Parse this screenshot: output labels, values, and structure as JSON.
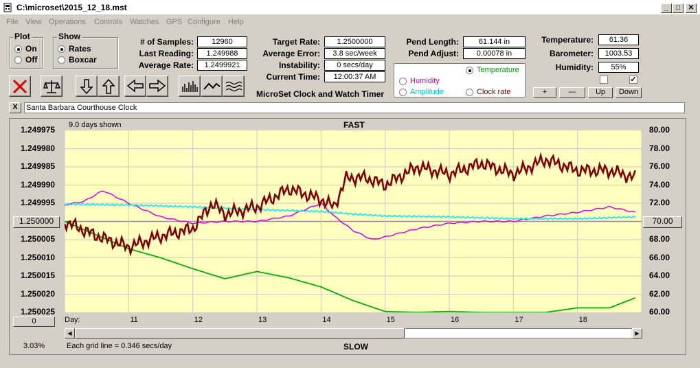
{
  "window": {
    "title": "C:\\microset\\2015_12_18.mst"
  },
  "menu": [
    "File",
    "View",
    "Operations",
    "Controls",
    "Watches",
    "GPS",
    "Configure",
    "Help"
  ],
  "plot_group": {
    "label": "Plot",
    "options": [
      "On",
      "Off"
    ],
    "selected": "On"
  },
  "show_group": {
    "label": "Show",
    "options": [
      "Rates",
      "Boxcar"
    ],
    "selected": "Rates"
  },
  "stats": {
    "samples_label": "# of Samples:",
    "samples": "12960",
    "last_reading_label": "Last Reading:",
    "last_reading": "1.249988",
    "average_rate_label": "Average Rate:",
    "average_rate": "1.2499921",
    "target_rate_label": "Target Rate:",
    "target_rate": "1.2500000",
    "average_error_label": "Average Error:",
    "average_error": "3.8 sec/week",
    "instability_label": "Instability:",
    "instability": "0 secs/day",
    "current_time_label": "Current Time:",
    "current_time": "12:00:37 AM",
    "app_caption": "MicroSet Clock and Watch Timer",
    "pend_length_label": "Pend Length:",
    "pend_length": "61.144 in",
    "pend_adjust_label": "Pend Adjust:",
    "pend_adjust": "0.00078 in",
    "temperature_label": "Temperature:",
    "temperature": "61.36",
    "barometer_label": "Barometer:",
    "barometer": "1003.53",
    "humidity_label": "Humidity:",
    "humidity": "55%"
  },
  "aux_select": {
    "options": [
      {
        "label": "Temperature",
        "color": "#00a000",
        "selected": true
      },
      {
        "label": "Humidity",
        "color": "#c000c0",
        "selected": false
      },
      {
        "label": "Amplitude",
        "color": "#00c0c0",
        "selected": false
      },
      {
        "label": "Clock rate",
        "color": "#800000",
        "selected": false
      }
    ]
  },
  "scale_buttons": [
    "+",
    "—",
    "Up",
    "Down"
  ],
  "checkboxes": [
    false,
    true
  ],
  "clock_name": "Santa Barbara Courthouse Clock",
  "close_x": "X",
  "colors": {
    "rate": "#800000",
    "temperature": "#00b000",
    "humidity": "#e000e0",
    "amplitude": "#20e8f0",
    "plot_bg": "#ffffc0"
  },
  "chart_data": {
    "type": "line",
    "top_label": "FAST",
    "bottom_label": "SLOW",
    "days_shown": "9.0 days shown",
    "grid_note": "Each grid line = 0.346 secs/day",
    "zoom_percent": "3.03%",
    "x_axis_label": "Day:",
    "x_ticks": [
      "11",
      "12",
      "13",
      "14",
      "15",
      "16",
      "17",
      "18"
    ],
    "x_range": [
      10,
      19
    ],
    "left_ticks": [
      "1.249975",
      "1.249980",
      "1.249985",
      "1.249990",
      "1.249995",
      "1.250000",
      "1.250005",
      "1.250010",
      "1.250015",
      "1.250020",
      "1.250025"
    ],
    "left_center_button": "1.250000",
    "left_bottom_button": "0",
    "right_ticks": [
      "80.00",
      "78.00",
      "76.00",
      "74.00",
      "72.00",
      "70.00",
      "68.00",
      "66.00",
      "64.00",
      "62.00",
      "60.00"
    ],
    "right_center_button": "70.00",
    "left_range": [
      1.249975,
      1.250025
    ],
    "right_range": [
      60,
      80
    ],
    "series": [
      {
        "name": "Temperature",
        "axis": "right",
        "x": [
          10,
          10.5,
          11,
          11.5,
          12,
          12.5,
          13,
          13.5,
          14,
          14.5,
          15,
          15.5,
          16,
          16.5,
          17,
          17.5,
          18,
          18.5,
          18.9
        ],
        "y": [
          70,
          68.5,
          67,
          66,
          64.8,
          63.7,
          64.5,
          63.8,
          62.8,
          61.3,
          60.1,
          60,
          60.1,
          60,
          60,
          60,
          60.5,
          60.5,
          61.6
        ]
      },
      {
        "name": "Humidity",
        "axis": "right",
        "x": [
          10,
          10.3,
          10.6,
          11,
          11.5,
          12,
          12.5,
          13,
          13.5,
          14,
          14.2,
          14.5,
          14.8,
          15,
          15.5,
          16,
          16.5,
          17,
          17.5,
          18,
          18.5,
          18.9
        ],
        "y": [
          71.8,
          72.2,
          73.4,
          72,
          70.5,
          69.8,
          70,
          70,
          70.6,
          72,
          70.6,
          69,
          68,
          68.3,
          69.2,
          69.8,
          70,
          70,
          70.6,
          71,
          71.6,
          71
        ]
      },
      {
        "name": "Amplitude",
        "axis": "right",
        "x": [
          10,
          11,
          12,
          13,
          14,
          14.5,
          15,
          16,
          17,
          18,
          18.9
        ],
        "y": [
          71.9,
          71.8,
          71.6,
          71.3,
          71.1,
          70.8,
          70.6,
          70.5,
          70.3,
          70.3,
          70.5
        ]
      },
      {
        "name": "Clock rate",
        "axis": "left",
        "x": [
          10,
          10.5,
          11,
          11.5,
          12,
          12.3,
          12.5,
          13,
          13.5,
          14,
          14.2,
          14.4,
          14.7,
          15,
          15.5,
          16,
          16.5,
          17,
          17.5,
          18,
          18.5,
          18.9
        ],
        "y": [
          1.25,
          1.250004,
          1.250007,
          1.250004,
          1.250002,
          1.249995,
          1.249998,
          1.249996,
          1.249991,
          1.249994,
          1.249996,
          1.249988,
          1.249988,
          1.24999,
          1.249985,
          1.249987,
          1.249984,
          1.249987,
          1.249983,
          1.249986,
          1.249986,
          1.249988
        ]
      }
    ]
  }
}
